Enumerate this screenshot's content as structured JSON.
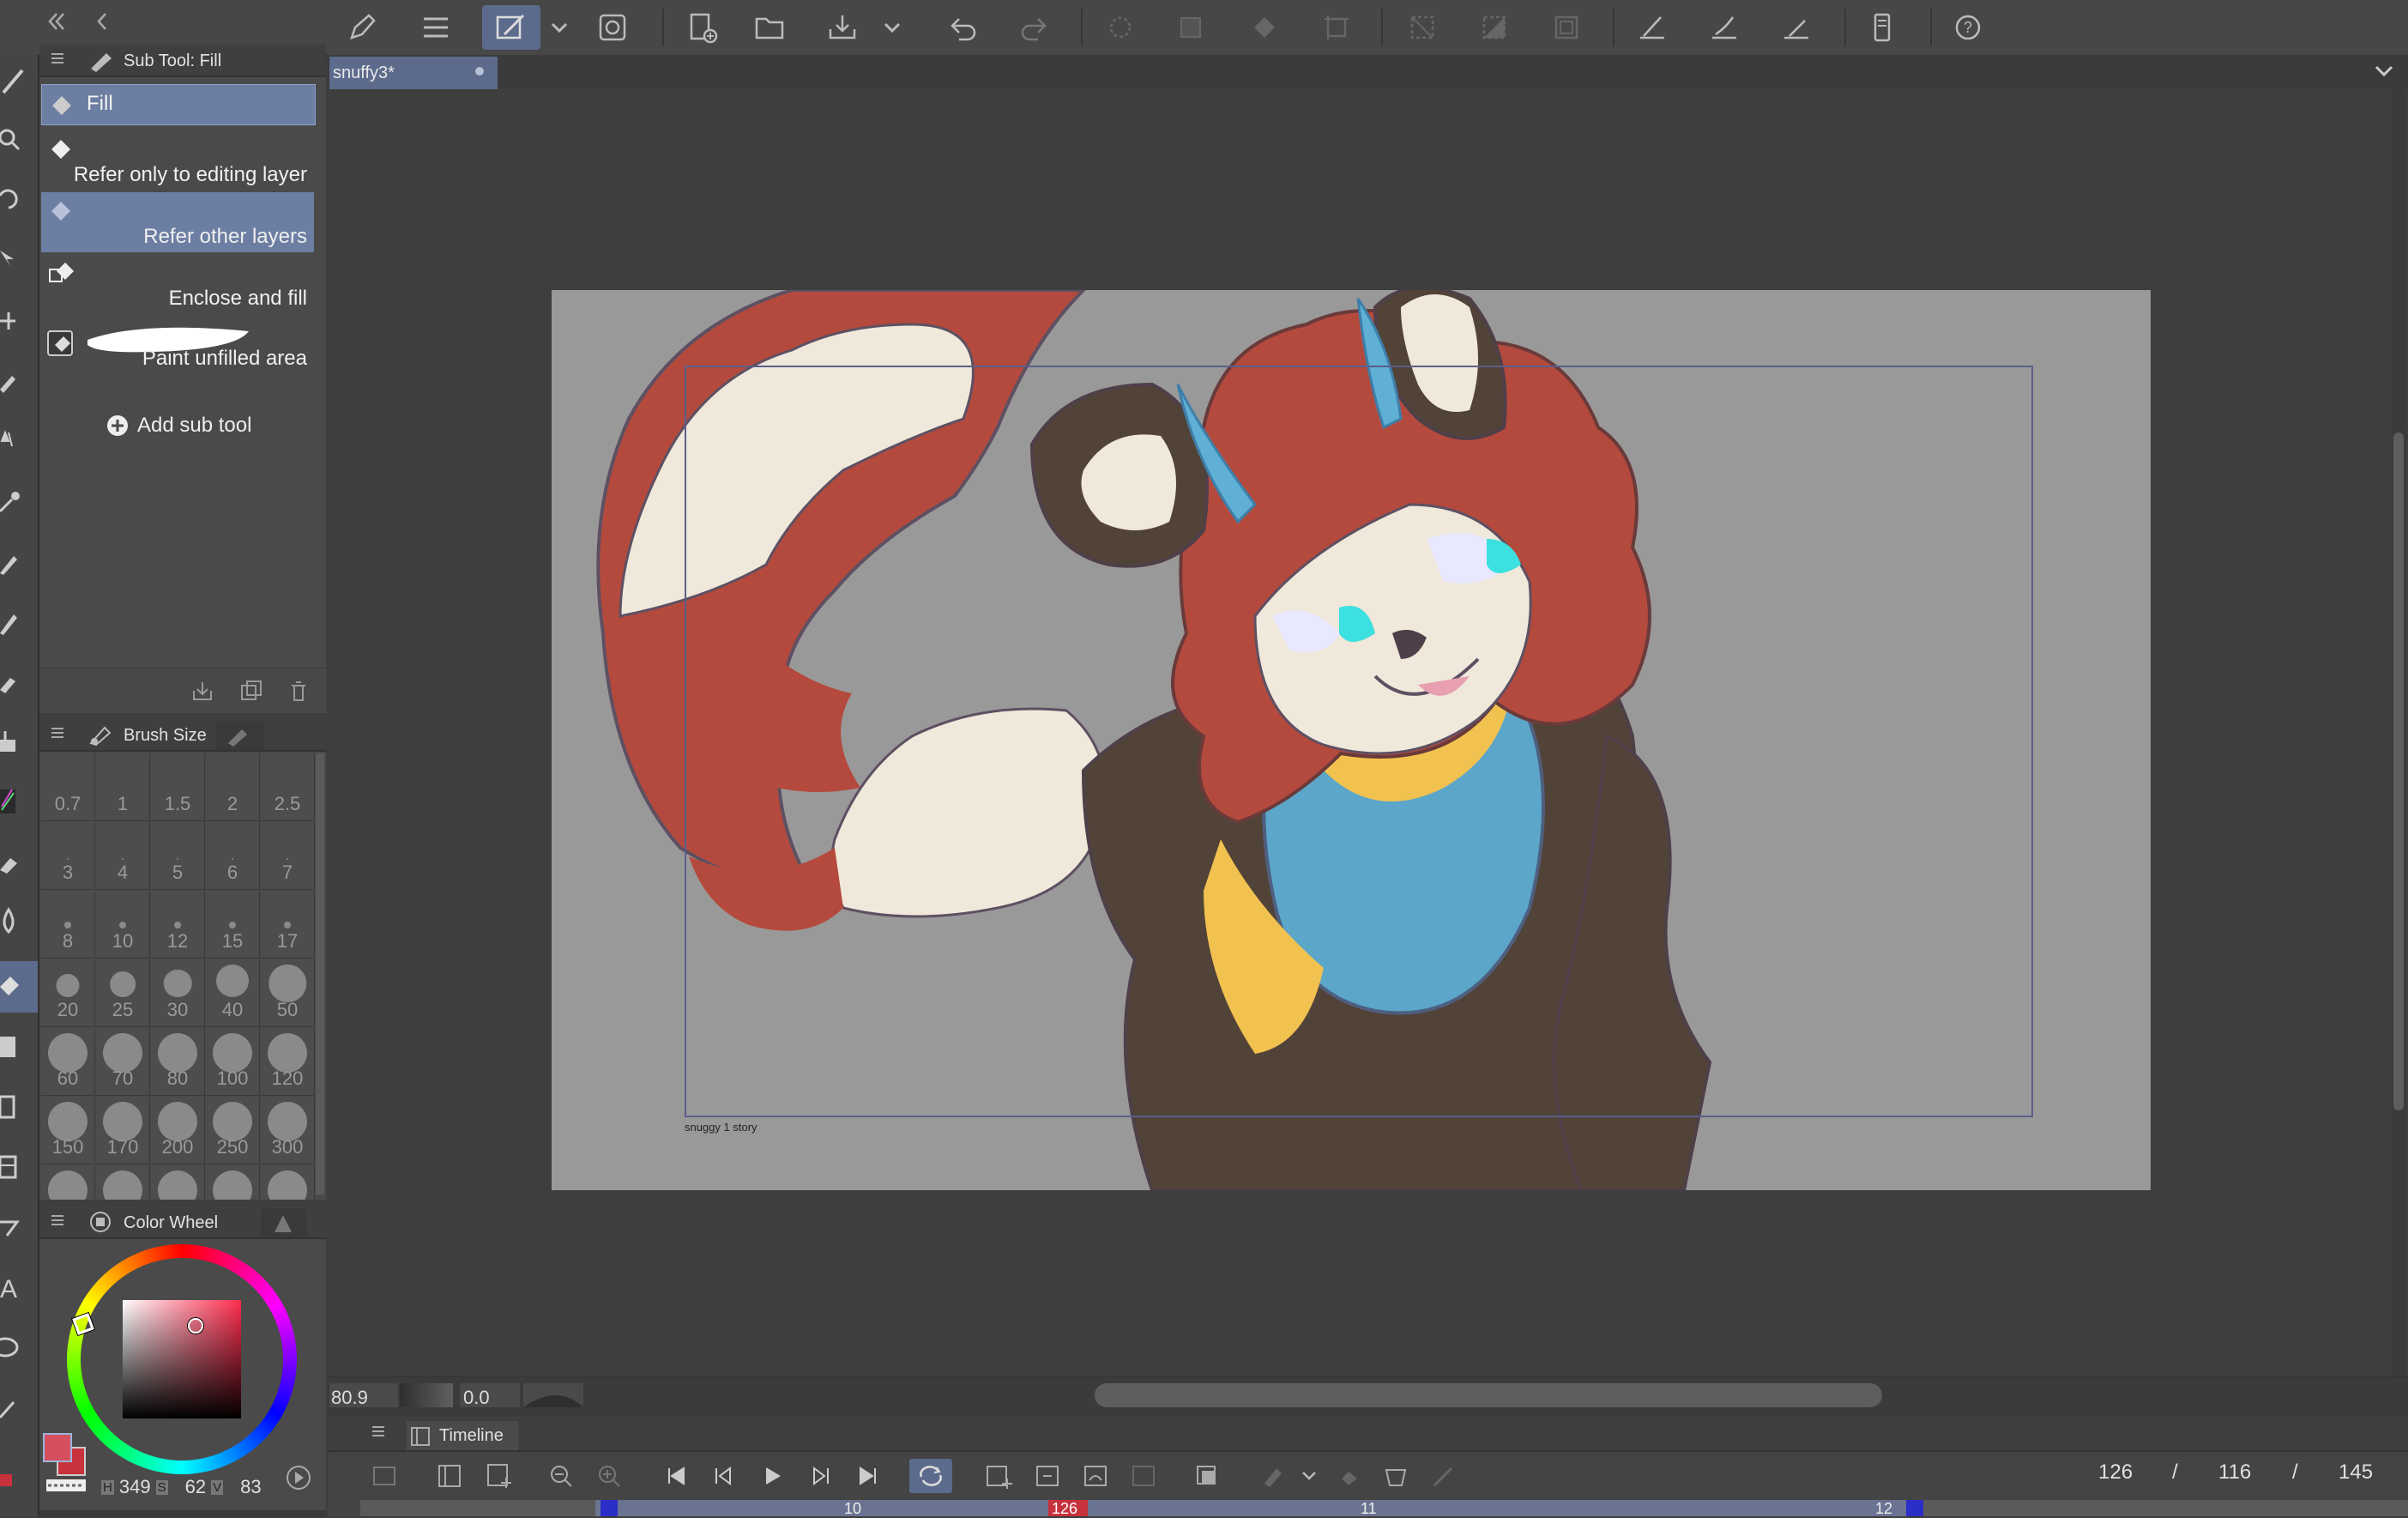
{
  "document": {
    "tab_title": "snuffy3*"
  },
  "subtool_panel": {
    "header": "Sub Tool: Fill",
    "items": [
      {
        "label": "Fill"
      },
      {
        "label": "Refer only to editing layer"
      },
      {
        "label": "Refer other layers"
      },
      {
        "label": "Enclose and fill"
      },
      {
        "label": "Paint unfilled area"
      }
    ],
    "add_label": "Add sub tool"
  },
  "brush_size_panel": {
    "header": "Brush Size",
    "sizes": [
      "0.7",
      "1",
      "1.5",
      "2",
      "2.5",
      "3",
      "4",
      "5",
      "6",
      "7",
      "8",
      "10",
      "12",
      "15",
      "17",
      "20",
      "25",
      "30",
      "40",
      "50",
      "60",
      "70",
      "80",
      "100",
      "120",
      "150",
      "170",
      "200",
      "250",
      "300"
    ]
  },
  "color_panel": {
    "header": "Color Wheel",
    "h_label": "H",
    "h_value": "349",
    "s_label": "S",
    "s_value": "62",
    "v_label": "V",
    "v_value": "83",
    "main_color": "#d4505f",
    "sub_color": "#c8323c"
  },
  "canvas": {
    "caption": "snuggy 1 story",
    "zoom": "80.9",
    "rotation": "0.0"
  },
  "timeline": {
    "header": "Timeline",
    "current_frame": "126",
    "frame_a": "116",
    "frame_b": "145",
    "slash": "/",
    "ruler_labels": [
      "10",
      "126",
      "11",
      "12"
    ]
  },
  "colors": {
    "accent": "#5c6b8c",
    "bg": "#3e3e3e",
    "panel": "#4a4a4a",
    "fur_red": "#b44a3d",
    "fur_cream": "#f0e8da",
    "fur_brown": "#524338",
    "bandana": "#5ba6c9",
    "bandana_trim": "#f2c250",
    "horn": "#5fb0d4",
    "eye": "#3de0e0"
  }
}
